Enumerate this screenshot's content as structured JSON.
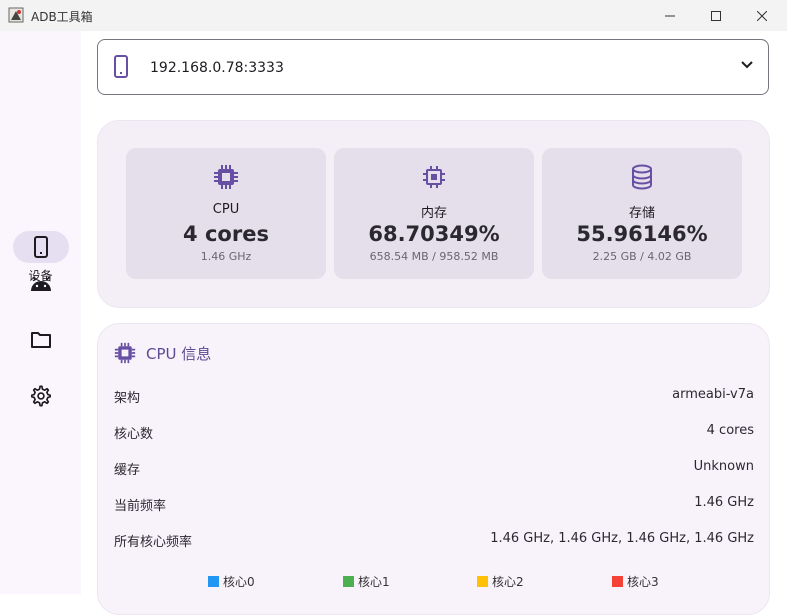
{
  "window": {
    "title": "ADB工具箱"
  },
  "colors": {
    "accent": "#6750a4",
    "core0": "#2196f3",
    "core1": "#4caf50",
    "core2": "#ffc107",
    "core3": "#f44336"
  },
  "rail": {
    "items": [
      {
        "icon": "phone-icon",
        "label": "设备",
        "selected": true
      },
      {
        "icon": "android-icon",
        "label": ""
      },
      {
        "icon": "folder-icon",
        "label": ""
      },
      {
        "icon": "gear-icon",
        "label": ""
      }
    ]
  },
  "device_selector": {
    "value": "192.168.0.78:3333"
  },
  "summary": {
    "cpu": {
      "label": "CPU",
      "value": "4 cores",
      "sub": "1.46 GHz"
    },
    "memory": {
      "label": "内存",
      "value": "68.70349%",
      "sub": "658.54 MB / 958.52 MB"
    },
    "storage": {
      "label": "存储",
      "value": "55.96146%",
      "sub": "2.25 GB / 4.02 GB"
    }
  },
  "cpu_info": {
    "title": "CPU 信息",
    "rows": [
      {
        "key": "架构",
        "value": "armeabi-v7a"
      },
      {
        "key": "核心数",
        "value": "4 cores"
      },
      {
        "key": "缓存",
        "value": "Unknown"
      },
      {
        "key": "当前频率",
        "value": "1.46 GHz"
      },
      {
        "key": "所有核心频率",
        "value": "1.46 GHz, 1.46 GHz, 1.46 GHz, 1.46 GHz"
      }
    ],
    "legend": [
      "核心0",
      "核心1",
      "核心2",
      "核心3"
    ]
  }
}
